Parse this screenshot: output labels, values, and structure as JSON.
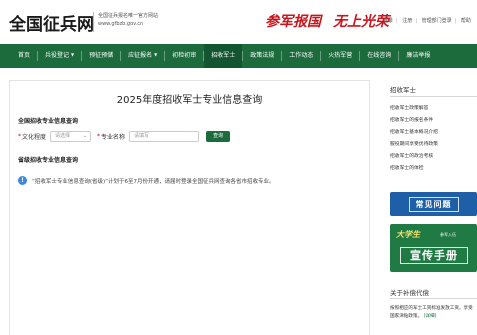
{
  "header": {
    "logo": "全国征兵网",
    "sub_line1": "全国征兵报名唯一官方网站",
    "sub_line2": "www.gfbzb.gov.cn",
    "slogan_1": "参军报国",
    "slogan_2": "无上光荣",
    "toplinks": [
      "登录",
      "注册",
      "管理部门登录",
      "帮助"
    ]
  },
  "nav": {
    "items": [
      {
        "label": "首页",
        "caret": false
      },
      {
        "label": "兵役登记",
        "caret": true
      },
      {
        "label": "预征预储",
        "caret": false
      },
      {
        "label": "应征报名",
        "caret": true
      },
      {
        "label": "初检初审",
        "caret": false
      },
      {
        "label": "招收军士",
        "caret": false,
        "active": true
      },
      {
        "label": "政策法规",
        "caret": false
      },
      {
        "label": "工作动态",
        "caret": false
      },
      {
        "label": "火热军营",
        "caret": false
      },
      {
        "label": "在线咨询",
        "caret": false
      },
      {
        "label": "廉洁举报",
        "caret": false
      }
    ]
  },
  "main": {
    "title": "2025年度招收军士专业信息查询",
    "section1": "全国招收专业信息查询",
    "form": {
      "education_label": "文化程度",
      "education_placeholder": "请选择",
      "major_label": "专业名称",
      "major_placeholder": "请填写",
      "query_label": "查询"
    },
    "section2": "省级招收专业信息查询",
    "notice": "“招收军士专业信息查询(省级)”计划于6至7月份开通，请届时登录全国征兵网查询各省市招收专业。"
  },
  "sidebar": {
    "title": "招收军士",
    "links": [
      "招收军士政策解答",
      "招收军士的报名条件",
      "招收军士基本概况介绍",
      "服役期间享受优待政策",
      "招收军士的政治考核",
      "招收军士的体检"
    ],
    "faq_banner": "常见问题",
    "handbook_top": "大学生",
    "handbook_sub": "参军入伍",
    "handbook_main": "宣传手册",
    "section2_title": "关于补偿代偿",
    "article": "按照相应的军士工资标准发放工资，享受国家津贴政策。",
    "more": "[详细]"
  },
  "colors": {
    "nav_green": "#1c6b3d",
    "slogan_red": "#c8161d",
    "faq_blue": "#1e5fa8",
    "notice_blue": "#3f8ad8"
  }
}
